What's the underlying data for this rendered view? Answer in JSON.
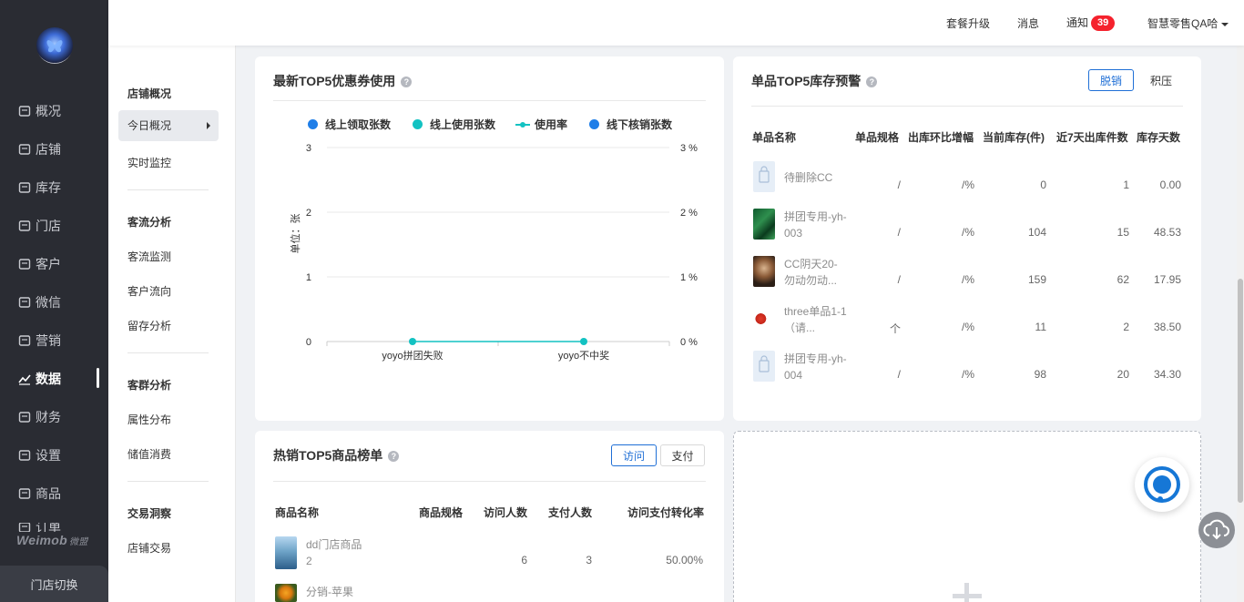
{
  "sidebar": {
    "items": [
      {
        "label": "概况",
        "icon": "overview-icon"
      },
      {
        "label": "店铺",
        "icon": "store-icon"
      },
      {
        "label": "库存",
        "icon": "inventory-icon"
      },
      {
        "label": "门店",
        "icon": "shop-icon"
      },
      {
        "label": "客户",
        "icon": "customer-icon"
      },
      {
        "label": "微信",
        "icon": "wechat-icon"
      },
      {
        "label": "营销",
        "icon": "marketing-icon"
      },
      {
        "label": "数据",
        "icon": "data-icon",
        "active": true
      },
      {
        "label": "财务",
        "icon": "finance-icon"
      },
      {
        "label": "设置",
        "icon": "settings-icon"
      },
      {
        "label": "商品",
        "icon": "product-icon"
      },
      {
        "label": "订单",
        "icon": "order-icon"
      }
    ],
    "brand": "Weimob",
    "brand_sub": "微盟",
    "switch_label": "门店切换"
  },
  "subnav": {
    "groups": [
      {
        "title": "店铺概况",
        "items": [
          "今日概况",
          "实时监控"
        ]
      },
      {
        "title": "客流分析",
        "items": [
          "客流监测",
          "客户流向",
          "留存分析"
        ]
      },
      {
        "title": "客群分析",
        "items": [
          "属性分布",
          "储值消费"
        ]
      },
      {
        "title": "交易洞察",
        "items": [
          "店铺交易"
        ]
      }
    ],
    "active": "今日概况"
  },
  "header": {
    "upgrade": "套餐升级",
    "messages": "消息",
    "notify": "通知",
    "notify_count": "39",
    "user": "智慧零售QA哈"
  },
  "coupon_card": {
    "title": "最新TOP5优惠券使用",
    "help": "?",
    "unit_label": "单位：张",
    "legend": [
      "线上领取张数",
      "线上使用张数",
      "使用率",
      "线下核销张数"
    ],
    "colors": {
      "online_receive": "#1f7ee8",
      "online_use": "#13c2c2",
      "rate": "#13c2c2",
      "offline": "#1f7ee8"
    },
    "y_left_ticks": [
      "3",
      "2",
      "1",
      "0"
    ],
    "y_right_ticks": [
      "3 %",
      "2 %",
      "1 %",
      "0 %"
    ]
  },
  "chart_data": {
    "type": "line",
    "categories": [
      "yoyo拼团失败",
      "yoyo不中奖"
    ],
    "series": [
      {
        "name": "线上领取张数",
        "values": [
          0,
          0
        ]
      },
      {
        "name": "线上使用张数",
        "values": [
          0,
          0
        ]
      },
      {
        "name": "使用率",
        "values": [
          0,
          0
        ]
      },
      {
        "name": "线下核销张数",
        "values": [
          0,
          0
        ]
      }
    ],
    "title": "最新TOP5优惠券使用",
    "ylabel": "单位：张",
    "ylim": [
      0,
      3
    ],
    "y2lim": [
      0,
      3
    ],
    "y2_unit": "%",
    "grid": true,
    "legend": "top"
  },
  "stock_card": {
    "title": "单品TOP5库存预警",
    "help": "?",
    "tabs": [
      "脱销",
      "积压"
    ],
    "columns": [
      "单品名称",
      "单品规格",
      "出库环比增幅",
      "当前库存(件)",
      "近7天出库件数",
      "库存天数"
    ],
    "rows": [
      {
        "name": "待删除CC",
        "spec": "/",
        "growth": "/%",
        "stock": "0",
        "out7": "1",
        "days": "0.00",
        "thumb": "placeholder"
      },
      {
        "name": "拼团专用-yh-003",
        "spec": "/",
        "growth": "/%",
        "stock": "104",
        "out7": "15",
        "days": "48.53",
        "thumb": "green"
      },
      {
        "name": "CC阴天20-勿动勿动...",
        "spec": "/",
        "growth": "/%",
        "stock": "159",
        "out7": "62",
        "days": "17.95",
        "thumb": "cat"
      },
      {
        "name": "three单品1-1（请...",
        "spec": "个",
        "growth": "/%",
        "stock": "11",
        "out7": "2",
        "days": "38.50",
        "thumb": "fruit"
      },
      {
        "name": "拼团专用-yh-004",
        "spec": "/",
        "growth": "/%",
        "stock": "98",
        "out7": "20",
        "days": "34.30",
        "thumb": "placeholder"
      }
    ]
  },
  "hot_card": {
    "title": "热销TOP5商品榜单",
    "help": "?",
    "tabs": [
      "访问",
      "支付"
    ],
    "columns": [
      "商品名称",
      "商品规格",
      "访问人数",
      "支付人数",
      "访问支付转化率"
    ],
    "rows": [
      {
        "name": "dd门店商品2",
        "spec": "",
        "visits": "6",
        "pays": "3",
        "rate": "50.00%",
        "thumb": "person"
      },
      {
        "name": "分销-苹果",
        "spec": "",
        "visits": "",
        "pays": "",
        "rate": "",
        "thumb": "orange"
      }
    ]
  }
}
